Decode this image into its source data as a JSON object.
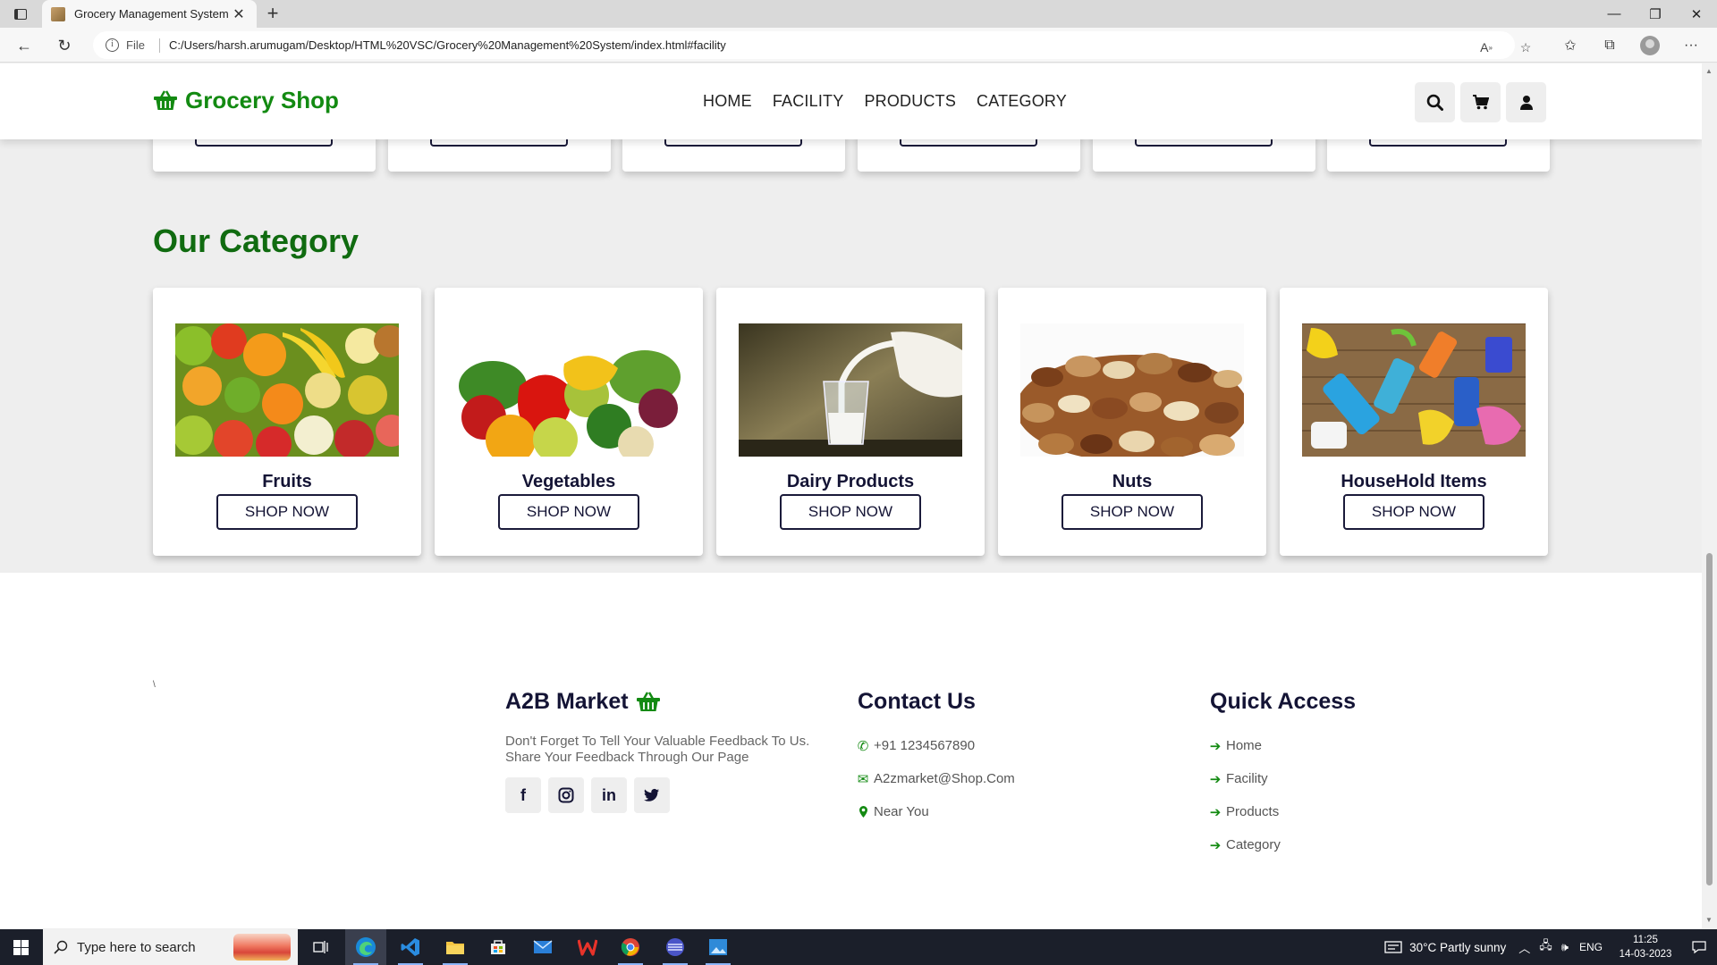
{
  "browser": {
    "tab_title": "Grocery Management System",
    "file_label": "File",
    "url": "C:/Users/harsh.arumugam/Desktop/HTML%20VSC/Grocery%20Management%20System/index.html#facility"
  },
  "header": {
    "logo_text": "Grocery Shop",
    "nav": [
      "HOME",
      "FACILITY",
      "PRODUCTS",
      "CATEGORY"
    ]
  },
  "category": {
    "title": "Our Category",
    "button_label": "SHOP NOW",
    "items": [
      {
        "name": "Fruits"
      },
      {
        "name": "Vegetables"
      },
      {
        "name": "Dairy Products"
      },
      {
        "name": "Nuts"
      },
      {
        "name": "HouseHold Items"
      }
    ]
  },
  "footer": {
    "stray_mark": "\\",
    "brand": {
      "title": "A2B Market",
      "text_line1": "Don't Forget To Tell Your Valuable Feedback To Us.",
      "text_line2": "Share Your Feedback Through Our Page",
      "social": [
        "f",
        "in"
      ]
    },
    "contact": {
      "title": "Contact Us",
      "phone": "+91 1234567890",
      "email": "A2zmarket@Shop.Com",
      "location": "Near You"
    },
    "quick": {
      "title": "Quick Access",
      "links": [
        "Home",
        "Facility",
        "Products",
        "Category"
      ]
    }
  },
  "taskbar": {
    "search_placeholder": "Type here to search",
    "weather": "30°C  Partly sunny",
    "language": "ENG",
    "time": "11:25",
    "date": "14-03-2023"
  },
  "colors": {
    "brand_green": "#138a12",
    "title_green": "#106b10",
    "navy_text": "#141435"
  }
}
